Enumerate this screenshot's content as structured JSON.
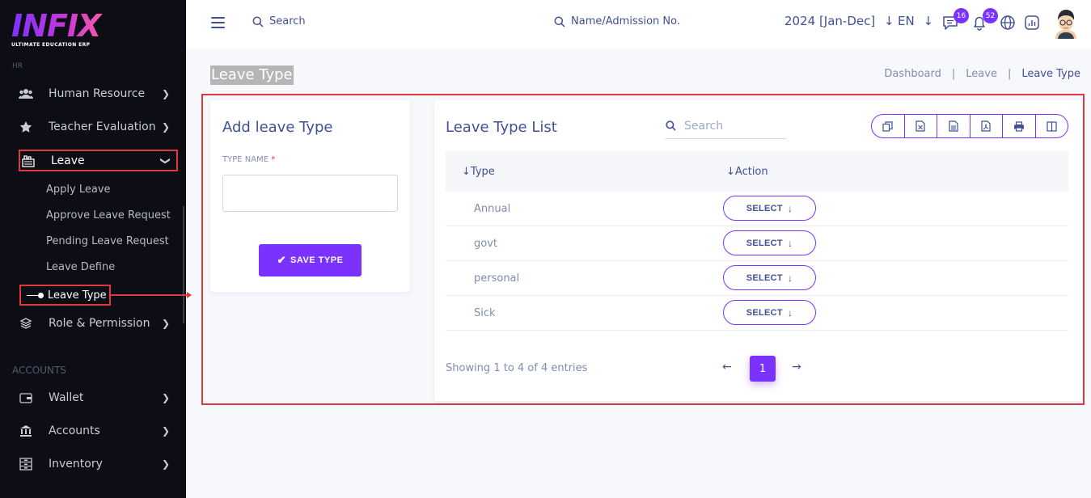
{
  "brand": {
    "logo": "INFIX",
    "tagline": "ULTIMATE EDUCATION ERP"
  },
  "sidebar": {
    "hr_label": "HR",
    "items": [
      {
        "label": "Human Resource",
        "icon": "users-icon"
      },
      {
        "label": "Teacher Evaluation",
        "icon": "star-icon"
      },
      {
        "label": "Leave",
        "icon": "leave-icon"
      }
    ],
    "submenu": [
      "Apply Leave",
      "Approve Leave Request",
      "Pending Leave Request",
      "Leave Define"
    ],
    "submenu_active": "Leave Type",
    "role_item": "Role & Permission",
    "accounts_label": "ACCOUNTS",
    "account_items": [
      "Wallet",
      "Accounts",
      "Inventory"
    ]
  },
  "header": {
    "search_label": "Search",
    "search2_label": "Name/Admission No.",
    "year": "2024 [Jan-Dec]",
    "lang": "EN",
    "chat_badge": "16",
    "notif_badge": "52"
  },
  "page": {
    "title": "Leave Type",
    "breadcrumb": [
      "Dashboard",
      "Leave",
      "Leave Type"
    ]
  },
  "add_form": {
    "title": "Add leave Type",
    "type_label": "TYPE NAME",
    "required_mark": "*",
    "type_value": "",
    "save_label": "SAVE TYPE"
  },
  "list": {
    "title": "Leave Type List",
    "search_placeholder": "Search",
    "columns": [
      "Type",
      "Action"
    ],
    "rows": [
      {
        "type": "Annual",
        "action": "SELECT"
      },
      {
        "type": "govt",
        "action": "SELECT"
      },
      {
        "type": "personal",
        "action": "SELECT"
      },
      {
        "type": "Sick",
        "action": "SELECT"
      }
    ],
    "showing": "Showing 1 to 4 of 4 entries",
    "current_page": "1"
  },
  "colors": {
    "accent": "#7c32ff",
    "highlight": "#e0383e",
    "sidebar_bg": "#0d0d16",
    "text": "#415094"
  }
}
